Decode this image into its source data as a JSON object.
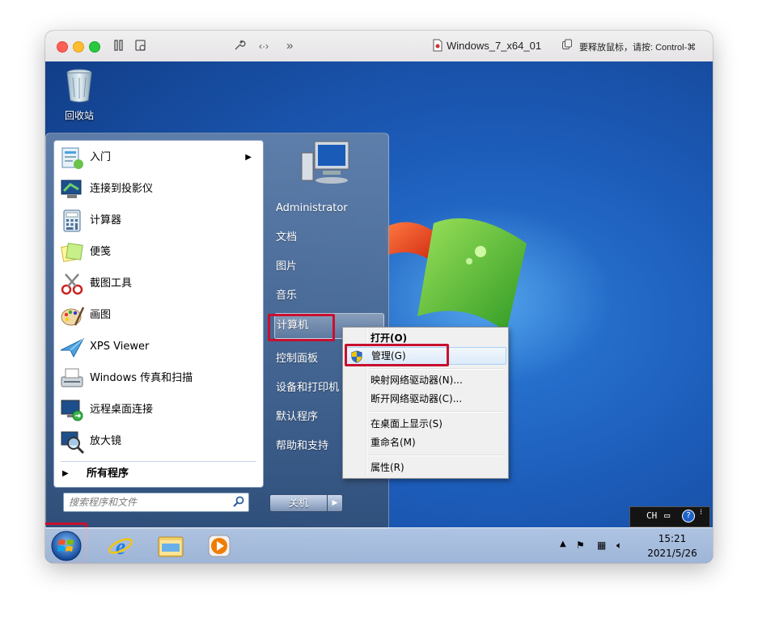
{
  "window": {
    "title": "Windows_7_x64_01",
    "release_hint": "要释放鼠标，请按: Control-⌘"
  },
  "desktop": {
    "recycle_bin_label": "回收站"
  },
  "start_menu": {
    "programs": [
      {
        "label": "入门",
        "icon": "getting-started-icon",
        "has_submenu": true
      },
      {
        "label": "连接到投影仪",
        "icon": "projector-icon"
      },
      {
        "label": "计算器",
        "icon": "calculator-icon"
      },
      {
        "label": "便笺",
        "icon": "sticky-notes-icon"
      },
      {
        "label": "截图工具",
        "icon": "snipping-tool-icon"
      },
      {
        "label": "画图",
        "icon": "paint-icon"
      },
      {
        "label": "XPS Viewer",
        "icon": "xps-viewer-icon"
      },
      {
        "label": "Windows 传真和扫描",
        "icon": "fax-scan-icon"
      },
      {
        "label": "远程桌面连接",
        "icon": "remote-desktop-icon"
      },
      {
        "label": "放大镜",
        "icon": "magnifier-icon"
      }
    ],
    "all_programs_label": "所有程序",
    "search_placeholder": "搜索程序和文件",
    "right_items": [
      {
        "label": "Administrator"
      },
      {
        "label": "文档"
      },
      {
        "label": "图片"
      },
      {
        "label": "音乐"
      },
      {
        "label": "计算机",
        "highlighted": true
      },
      {
        "label": "控制面板"
      },
      {
        "label": "设备和打印机"
      },
      {
        "label": "默认程序"
      },
      {
        "label": "帮助和支持"
      }
    ],
    "shutdown_label": "关机"
  },
  "context_menu": {
    "items": [
      {
        "label": "打开(O)",
        "bold": true
      },
      {
        "label": "管理(G)",
        "shield": true,
        "hover": true
      },
      {
        "label": "映射网络驱动器(N)..."
      },
      {
        "label": "断开网络驱动器(C)..."
      },
      {
        "label": "在桌面上显示(S)"
      },
      {
        "label": "重命名(M)"
      },
      {
        "label": "属性(R)"
      }
    ]
  },
  "language_bar": {
    "lang": "CH"
  },
  "taskbar": {
    "time": "15:21",
    "date": "2021/5/26"
  },
  "colors": {
    "highlight_box": "#c8102e",
    "desktop_blue": "#1c5bb8"
  }
}
